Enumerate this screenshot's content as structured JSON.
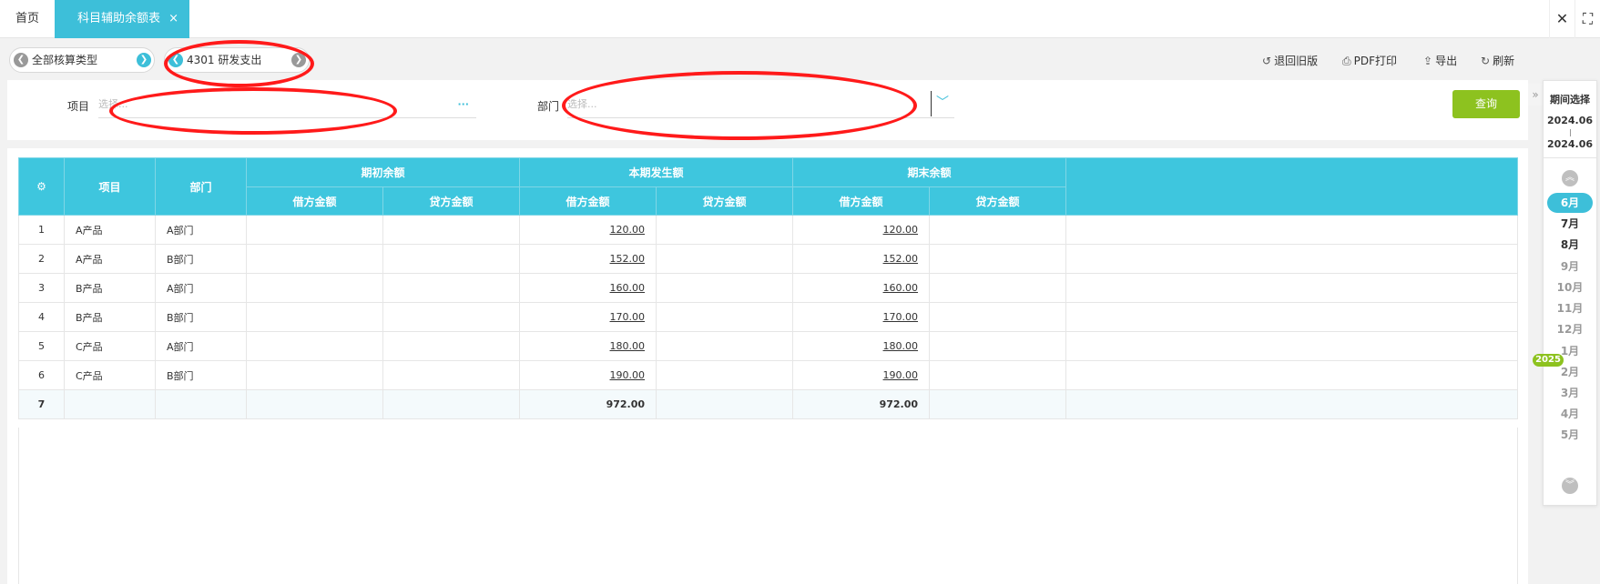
{
  "tabs": {
    "home": "首页",
    "active": "科目辅助余额表",
    "close_glyph": "×"
  },
  "window": {
    "close": "✕",
    "fullscreen": "⛶"
  },
  "toolbar": {
    "type_selector": "全部核算类型",
    "account_selector": "4301 研发支出",
    "actions": {
      "old_version": "退回旧版",
      "pdf_print": "PDF打印",
      "export": "导出",
      "refresh": "刷新"
    }
  },
  "filter": {
    "project_label": "项目",
    "project_placeholder": "选择...",
    "dept_label": "部门",
    "dept_placeholder": "选择...",
    "query_button": "查询"
  },
  "table": {
    "headers": {
      "project": "项目",
      "dept": "部门",
      "opening": "期初余额",
      "current": "本期发生额",
      "closing": "期末余额",
      "debit": "借方金额",
      "credit": "贷方金额"
    },
    "rows": [
      {
        "no": "1",
        "project": "A产品",
        "dept": "A部门",
        "cur_debit": "120.00",
        "close_debit": "120.00"
      },
      {
        "no": "2",
        "project": "A产品",
        "dept": "B部门",
        "cur_debit": "152.00",
        "close_debit": "152.00"
      },
      {
        "no": "3",
        "project": "B产品",
        "dept": "A部门",
        "cur_debit": "160.00",
        "close_debit": "160.00"
      },
      {
        "no": "4",
        "project": "B产品",
        "dept": "B部门",
        "cur_debit": "170.00",
        "close_debit": "170.00"
      },
      {
        "no": "5",
        "project": "C产品",
        "dept": "A部门",
        "cur_debit": "180.00",
        "close_debit": "180.00"
      },
      {
        "no": "6",
        "project": "C产品",
        "dept": "B部门",
        "cur_debit": "190.00",
        "close_debit": "190.00"
      }
    ],
    "total": {
      "no": "7",
      "cur_debit": "972.00",
      "close_debit": "972.00"
    }
  },
  "period": {
    "title": "期间选择",
    "start": "2024.06",
    "end": "2024.06",
    "year_badge": "2025",
    "months": [
      "6月",
      "7月",
      "8月",
      "9月",
      "10月",
      "11月",
      "12月",
      "1月",
      "2月",
      "3月",
      "4月",
      "5月"
    ],
    "selected_month": "6月"
  },
  "colors": {
    "accent": "#3dbfd9",
    "header_bg": "#3ec6de",
    "query_button": "#8dc21f",
    "annotation": "#ff1a1a"
  }
}
